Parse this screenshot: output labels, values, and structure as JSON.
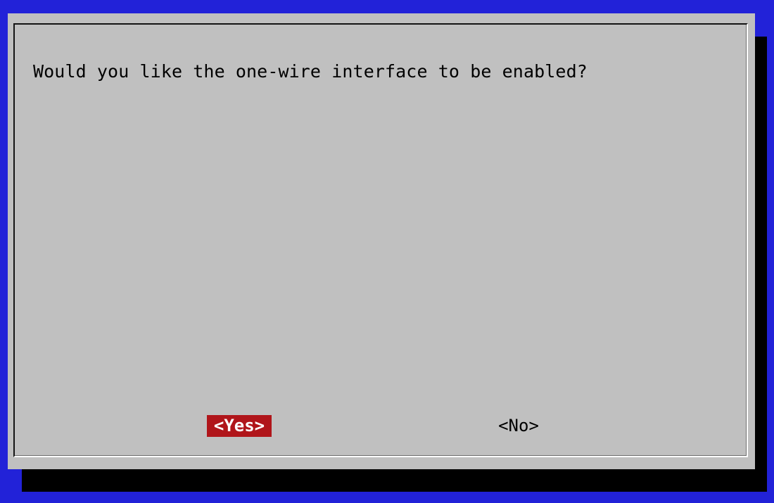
{
  "dialog": {
    "message": "Would you like the one-wire interface to be enabled?",
    "buttons": {
      "yes_label": "<Yes>",
      "no_label": "<No>",
      "selected": "yes"
    }
  },
  "colors": {
    "background": "#2222d8",
    "dialog": "#c0c0c0",
    "shadow": "#000000",
    "selected_button": "#b0151a",
    "selected_text": "#ffffff",
    "text": "#000000"
  }
}
